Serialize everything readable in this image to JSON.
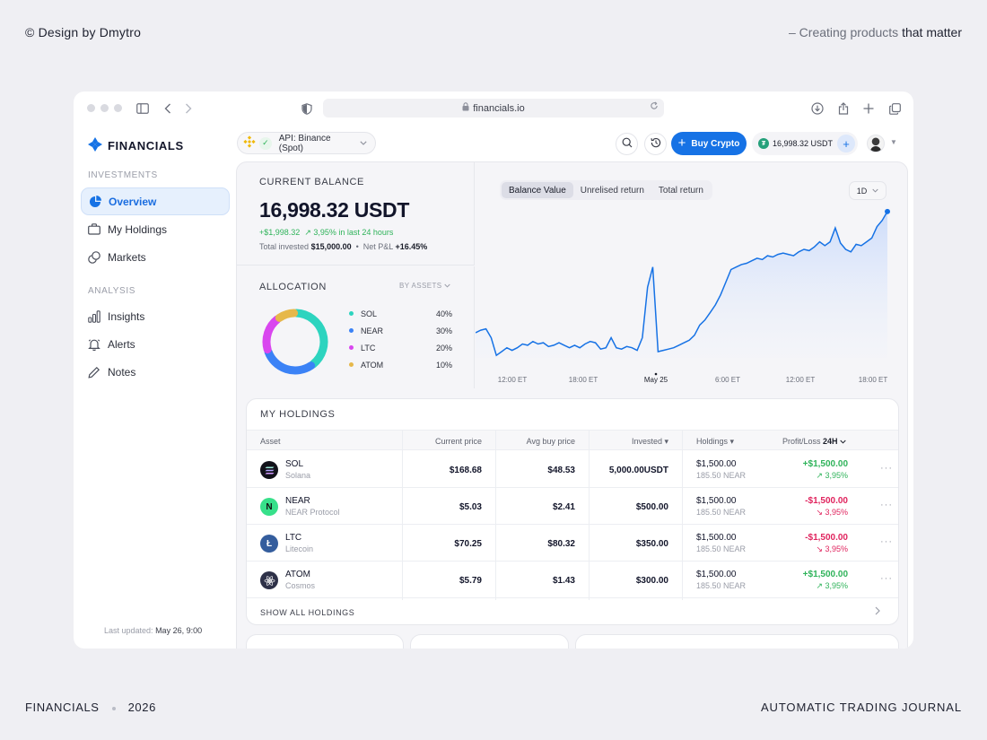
{
  "page": {
    "credit": "© Design by Dmytro",
    "tagline_lead": "– Creating products",
    "tagline_bold": "that matter",
    "footer_brand": "FINANCIALS",
    "footer_year": "2026",
    "footer_right": "AUTOMATIC TRADING JOURNAL"
  },
  "browser": {
    "url": "financials.io"
  },
  "sidebar": {
    "brand": "FINANCIALS",
    "sections": [
      {
        "title": "INVESTMENTS",
        "items": [
          {
            "label": "Overview",
            "icon": "pie-chart-icon",
            "active": true
          },
          {
            "label": "My Holdings",
            "icon": "briefcase-icon"
          },
          {
            "label": "Markets",
            "icon": "coins-icon"
          }
        ]
      },
      {
        "title": "ANALYSIS",
        "items": [
          {
            "label": "Insights",
            "icon": "bar-chart-icon"
          },
          {
            "label": "Alerts",
            "icon": "bell-icon"
          },
          {
            "label": "Notes",
            "icon": "pencil-icon"
          }
        ]
      }
    ],
    "last_updated_label": "Last updated:",
    "last_updated_value": "May 26, 9:00"
  },
  "topbar": {
    "api_label": "API: Binance (Spot)",
    "buy_label": "Buy Crypto",
    "balance_pill": "16,998.32 USDT"
  },
  "balance": {
    "title": "CURRENT BALANCE",
    "value": "16,998.32 USDT",
    "change_abs": "+$1,998.32",
    "change_pct": "↗ 3,95% in last 24 hours",
    "invested_label": "Total invested",
    "invested_value": "$15,000.00",
    "pnl_label": "Net P&L",
    "pnl_value": "+16.45%"
  },
  "allocation": {
    "title": "ALLOCATION",
    "by_label": "BY ASSETS",
    "items": [
      {
        "name": "SOL",
        "pct": "40%",
        "value": 40,
        "color": "#2dd4bf"
      },
      {
        "name": "NEAR",
        "pct": "30%",
        "value": 30,
        "color": "#3b82f6"
      },
      {
        "name": "LTC",
        "pct": "20%",
        "value": 20,
        "color": "#d946ef"
      },
      {
        "name": "ATOM",
        "pct": "10%",
        "value": 10,
        "color": "#e6b84a"
      }
    ]
  },
  "chart_tabs": [
    "Balance Value",
    "Unrelised return",
    "Total return"
  ],
  "chart_range": "1D",
  "chart_data": {
    "type": "area",
    "x_ticks": [
      "12:00 ET",
      "18:00 ET",
      "May 25",
      "6:00 ET",
      "12:00 ET",
      "18:00 ET"
    ],
    "y": [
      16540,
      16560,
      16570,
      16500,
      16360,
      16390,
      16420,
      16400,
      16420,
      16450,
      16440,
      16470,
      16450,
      16460,
      16430,
      16440,
      16460,
      16440,
      16420,
      16440,
      16420,
      16450,
      16470,
      16460,
      16410,
      16420,
      16500,
      16420,
      16410,
      16430,
      16420,
      16400,
      16500,
      16900,
      17060,
      16390,
      16400,
      16410,
      16420,
      16440,
      16460,
      16480,
      16520,
      16600,
      16640,
      16700,
      16760,
      16840,
      16940,
      17040,
      17060,
      17080,
      17090,
      17110,
      17130,
      17120,
      17150,
      17140,
      17160,
      17170,
      17160,
      17150,
      17180,
      17200,
      17190,
      17220,
      17260,
      17230,
      17260,
      17370,
      17250,
      17200,
      17180,
      17240,
      17230,
      17260,
      17290,
      17380,
      17430,
      17500
    ],
    "color": "#1672e5"
  },
  "holdings": {
    "title": "MY HOLDINGS",
    "columns": [
      "Asset",
      "Current price",
      "Avg buy price",
      "Invested",
      "Holdings",
      "Profit/Loss",
      "24H"
    ],
    "rows": [
      {
        "symbol": "SOL",
        "name": "Solana",
        "current": "$168.68",
        "avg": "$48.53",
        "invested": "5,000.00USDT",
        "holdings": "$1,500.00",
        "holdings_sub": "185.50 NEAR",
        "pl": "+$1,500.00",
        "pl_sub": "↗ 3,95%",
        "positive": true,
        "icon": "solana-icon"
      },
      {
        "symbol": "NEAR",
        "name": "NEAR Protocol",
        "current": "$5.03",
        "avg": "$2.41",
        "invested": "$500.00",
        "holdings": "$1,500.00",
        "holdings_sub": "185.50 NEAR",
        "pl": "-$1,500.00",
        "pl_sub": "↘ 3,95%",
        "positive": false,
        "icon": "near-icon"
      },
      {
        "symbol": "LTC",
        "name": "Litecoin",
        "current": "$70.25",
        "avg": "$80.32",
        "invested": "$350.00",
        "holdings": "$1,500.00",
        "holdings_sub": "185.50 NEAR",
        "pl": "-$1,500.00",
        "pl_sub": "↘ 3,95%",
        "positive": false,
        "icon": "litecoin-icon"
      },
      {
        "symbol": "ATOM",
        "name": "Cosmos",
        "current": "$5.79",
        "avg": "$1.43",
        "invested": "$300.00",
        "holdings": "$1,500.00",
        "holdings_sub": "185.50 NEAR",
        "pl": "+$1,500.00",
        "pl_sub": "↗ 3,95%",
        "positive": true,
        "icon": "cosmos-icon"
      }
    ],
    "show_all": "SHOW ALL HOLDINGS"
  }
}
